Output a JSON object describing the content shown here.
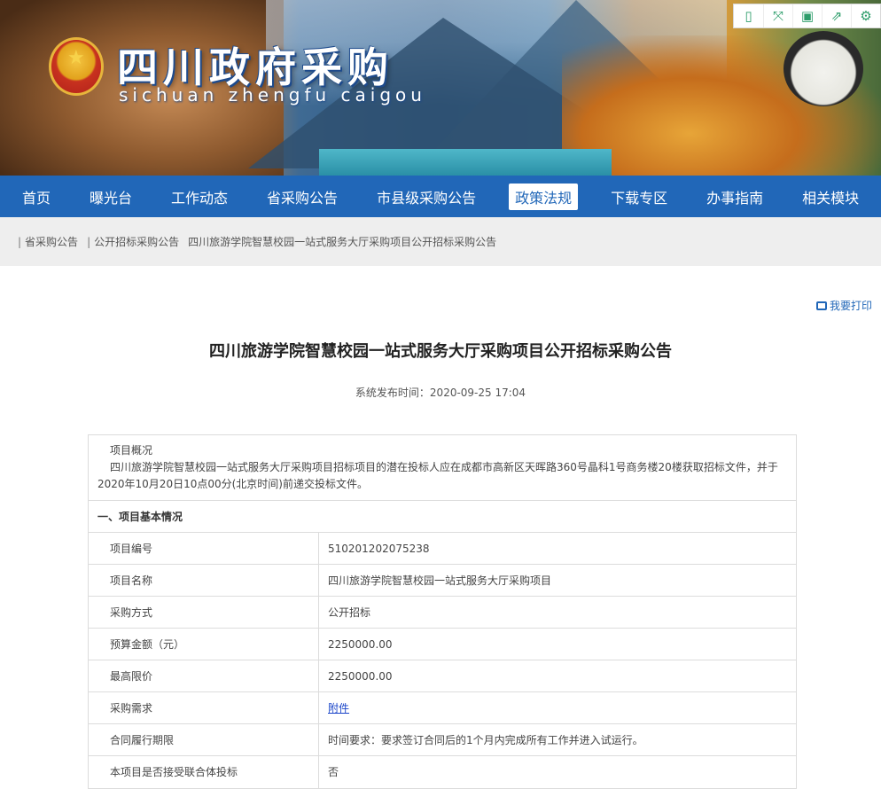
{
  "header": {
    "title": "四川政府采购",
    "subtitle": "sichuan  zhengfu  caigou",
    "tools": [
      {
        "name": "bookmark-icon",
        "glyph": "▯"
      },
      {
        "name": "fullscreen-icon",
        "glyph": "⤧"
      },
      {
        "name": "save-icon",
        "glyph": "▣"
      },
      {
        "name": "share-icon",
        "glyph": "⇗"
      },
      {
        "name": "settings-icon",
        "glyph": "⚙"
      }
    ]
  },
  "nav": {
    "items": [
      "首页",
      "曝光台",
      "工作动态",
      "省采购公告",
      "市县级采购公告",
      "政策法规",
      "下载专区",
      "办事指南",
      "相关模块"
    ],
    "active_index": 5
  },
  "breadcrumb": {
    "items": [
      "省采购公告",
      "公开招标采购公告",
      "四川旅游学院智慧校园一站式服务大厅采购项目公开招标采购公告"
    ]
  },
  "article": {
    "print_label": "我要打印",
    "title": "四川旅游学院智慧校园一站式服务大厅采购项目公开招标采购公告",
    "publish_time": "系统发布时间：2020-09-25 17:04",
    "overview_heading": "项目概况",
    "overview_text": "四川旅游学院智慧校园一站式服务大厅采购项目招标项目的潜在投标人应在成都市高新区天晖路360号晶科1号商务楼20楼获取招标文件，并于2020年10月20日10点00分(北京时间)前递交投标文件。",
    "section_title": "一、项目基本情况",
    "rows": [
      {
        "key": "项目编号",
        "value": "510201202075238"
      },
      {
        "key": "项目名称",
        "value": "四川旅游学院智慧校园一站式服务大厅采购项目"
      },
      {
        "key": "采购方式",
        "value": "公开招标"
      },
      {
        "key": "预算金额（元）",
        "value": "2250000.00"
      },
      {
        "key": "最高限价",
        "value": "2250000.00"
      },
      {
        "key": "采购需求",
        "value": "附件"
      },
      {
        "key": "合同履行期限",
        "value": "时间要求：要求签订合同后的1个月内完成所有工作并进入试运行。"
      },
      {
        "key": "本项目是否接受联合体投标",
        "value": "否"
      }
    ]
  }
}
